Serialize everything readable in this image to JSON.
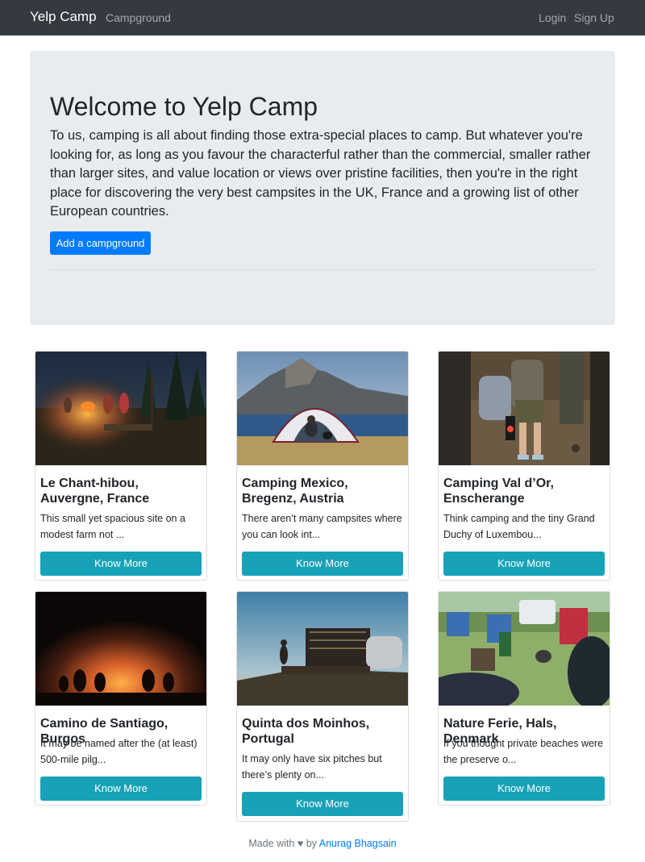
{
  "navbar": {
    "brand": "Yelp Camp",
    "links": {
      "campground": "Campground",
      "login": "Login",
      "signup": "Sign Up"
    }
  },
  "jumbotron": {
    "title": "Welcome to Yelp Camp",
    "lead": "To us, camping is all about finding those extra-special places to camp. But whatever you're looking for, as long as you favour the characterful rather than the commercial, smaller rather than larger sites, and value location or views over pristine facilities, then you're in the right place for discovering the very best campsites in the UK, France and a growing list of other European countries.",
    "button_label": "Add a campground"
  },
  "cards": [
    {
      "title": "Le Chant-hibou, Auvergne, France",
      "text": "This small yet spacious site on a modest farm not ...",
      "button": "Know More"
    },
    {
      "title": "Camping Mexico, Bregenz, Austria",
      "text": "There aren’t many campsites where you can look int...",
      "button": "Know More"
    },
    {
      "title": "Camping Val d’Or, Enscherange",
      "text": "Think camping and the tiny Grand Duchy of Luxembou...",
      "button": "Know More"
    },
    {
      "title": "Camino de Santiago, Burgos",
      "text": "It may be named after the (at least) 500-mile pilg...",
      "button": "Know More"
    },
    {
      "title": "Quinta dos Moinhos, Portugal",
      "text": "It may only have six pitches but there’s plenty on...",
      "button": "Know More"
    },
    {
      "title": "Nature Ferie, Hals, Denmark",
      "text": "If you thought private beaches were the preserve o...",
      "button": "Know More"
    }
  ],
  "footer": {
    "prefix": "Made with",
    "heart": "♥",
    "by": "by",
    "author": "Anurag Bhagsain"
  },
  "colors": {
    "navbar": "#343a40",
    "jumbotron": "#e9ecef",
    "primary": "#007bff",
    "info": "#17a2b8"
  }
}
